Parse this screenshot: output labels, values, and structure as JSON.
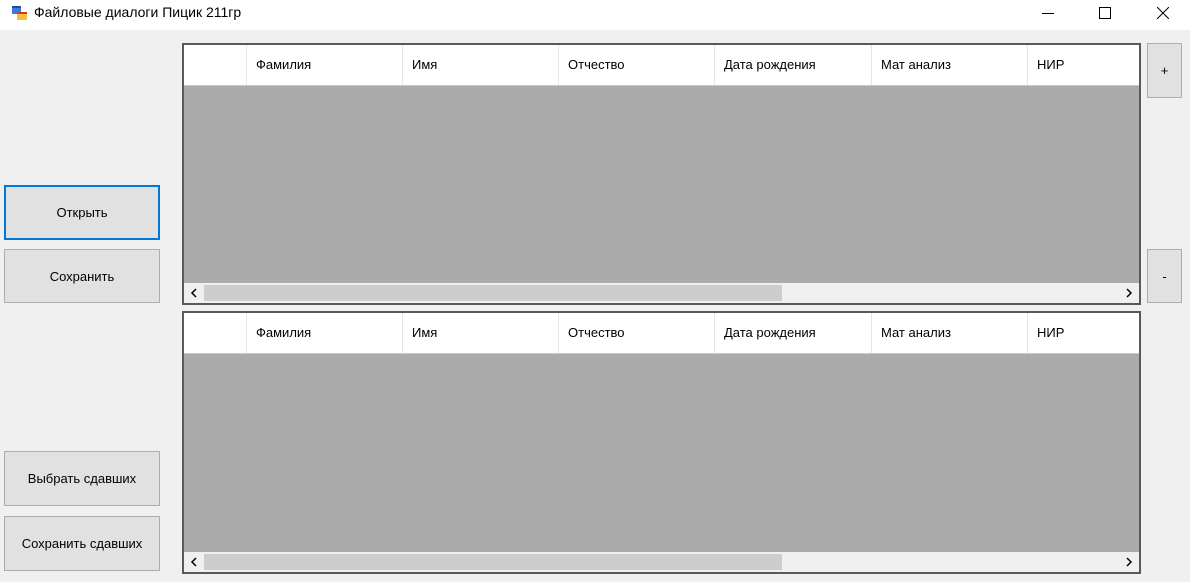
{
  "window": {
    "title": "Файловые диалоги Пицик 211гр",
    "minimize_icon": "minimize-icon",
    "maximize_icon": "maximize-icon",
    "close_icon": "close-icon"
  },
  "buttons": {
    "open": "Открыть",
    "save": "Сохранить",
    "select_passed": "Выбрать сдавших",
    "save_passed": "Сохранить сдавших",
    "add_row": "+",
    "remove_row": "-"
  },
  "grid_top": {
    "columns": [
      "Фамилия",
      "Имя",
      "Отчество",
      "Дата рождения",
      "Мат анализ",
      "НИР"
    ]
  },
  "grid_bottom": {
    "columns": [
      "Фамилия",
      "Имя",
      "Отчество",
      "Дата рождения",
      "Мат анализ",
      "НИР"
    ]
  },
  "colors": {
    "grid_background": "#ababab",
    "focus_border": "#0078d7",
    "button_face": "#e1e1e1"
  }
}
